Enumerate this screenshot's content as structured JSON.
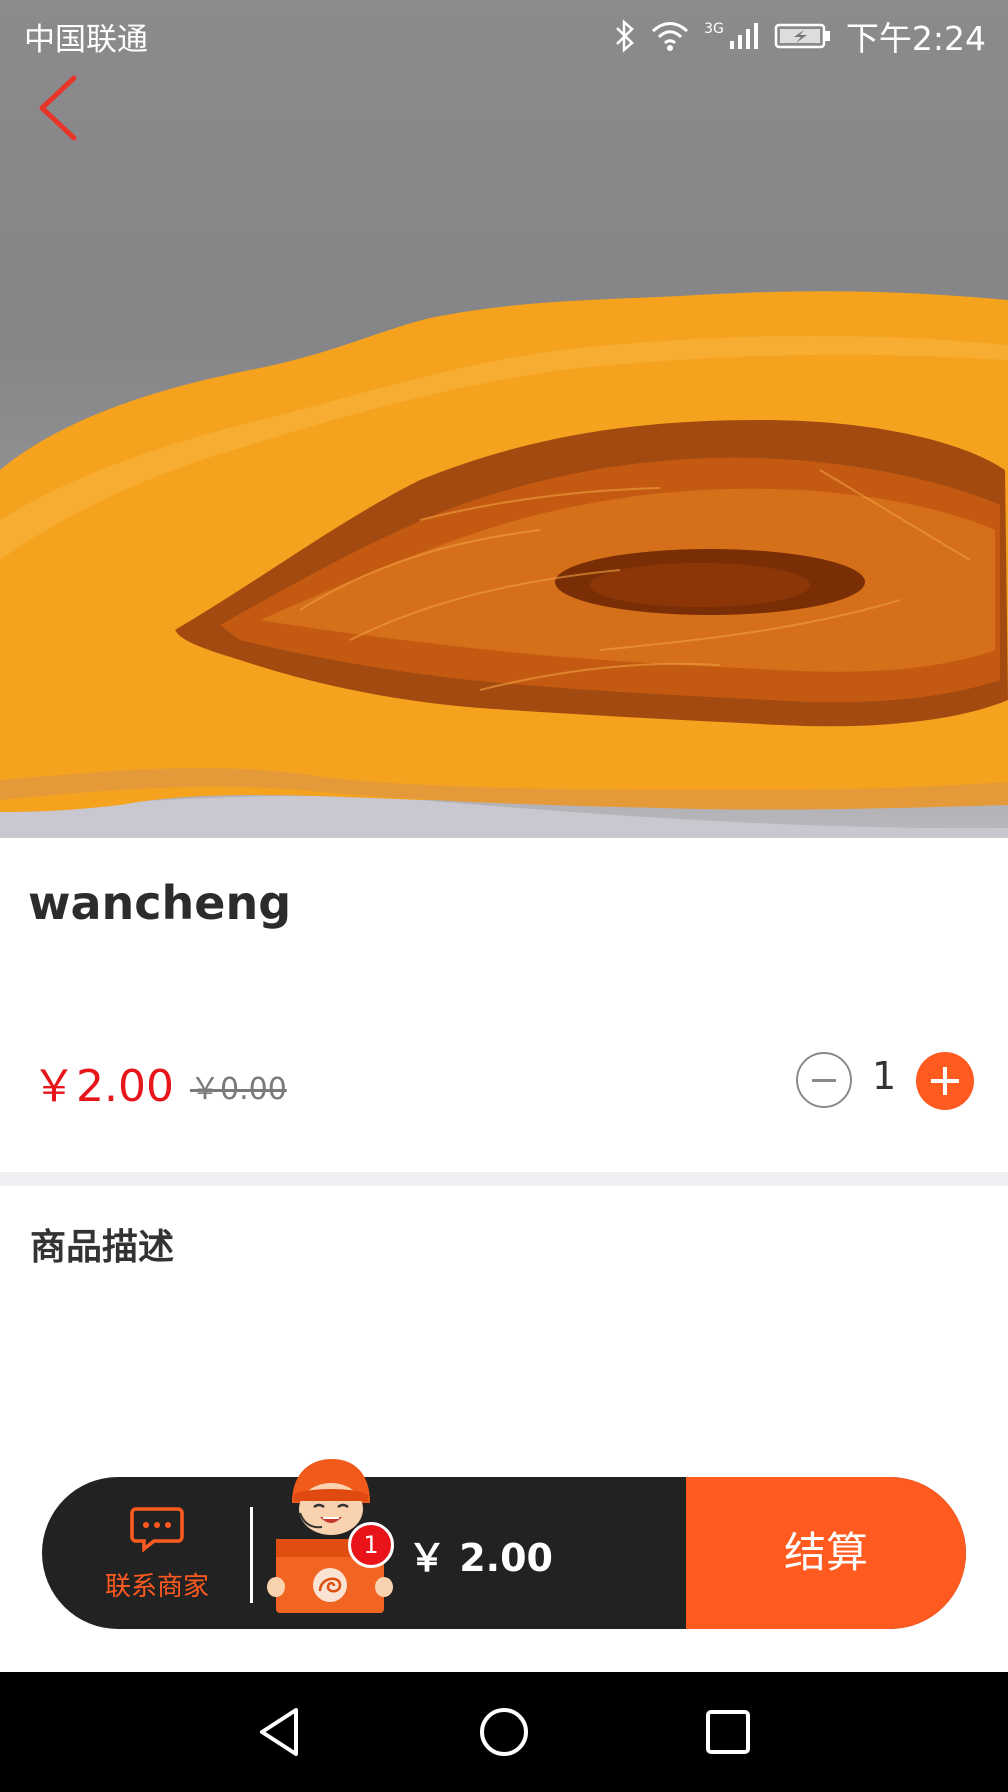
{
  "status_bar": {
    "carrier": "中国联通",
    "network": "3G",
    "time": "下午2:24"
  },
  "product": {
    "name": "wancheng",
    "price": "￥2.00",
    "original_price": "￥0.00",
    "quantity": "1",
    "description_title": "商品描述"
  },
  "cart_bar": {
    "contact_label": "联系商家",
    "cart_count": "1",
    "total": "￥ 2.00",
    "checkout_label": "结算"
  },
  "colors": {
    "accent": "#ff5a1f",
    "price_red": "#e6161b",
    "bar_dark": "#222222"
  },
  "icons": {
    "back": "chevron-left-icon",
    "contact": "chat-bubble-icon",
    "cart": "delivery-mascot-icon",
    "nav_back": "triangle-back-icon",
    "nav_home": "circle-home-icon",
    "nav_recent": "square-recent-icon"
  }
}
